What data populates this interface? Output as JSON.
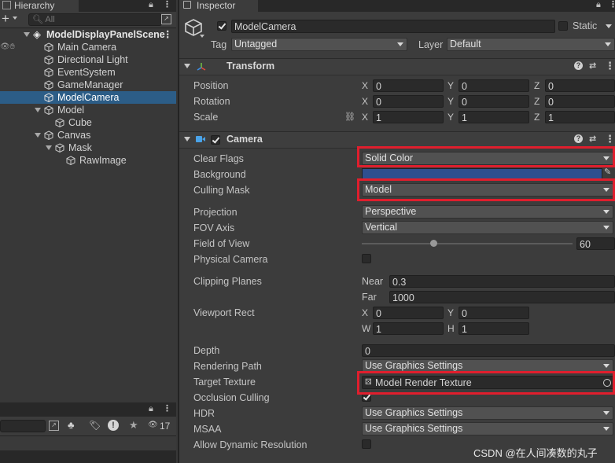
{
  "hierarchy": {
    "tab_label": "Hierarchy",
    "search_placeholder": "All",
    "add_label": "+",
    "scene_name": "ModelDisplayPanelScene",
    "items": [
      {
        "label": "Main Camera"
      },
      {
        "label": "Directional Light"
      },
      {
        "label": "EventSystem"
      },
      {
        "label": "GameManager"
      },
      {
        "label": "ModelCamera",
        "selected": true
      },
      {
        "label": "Model"
      },
      {
        "label": "Cube"
      },
      {
        "label": "Canvas"
      },
      {
        "label": "Mask"
      },
      {
        "label": "RawImage"
      }
    ],
    "bottom_count": "17"
  },
  "inspector": {
    "tab_label": "Inspector",
    "object_name": "ModelCamera",
    "static_label": "Static",
    "tag_label": "Tag",
    "tag_value": "Untagged",
    "layer_label": "Layer",
    "layer_value": "Default",
    "transform": {
      "title": "Transform",
      "rows": [
        {
          "label": "Position",
          "x": "0",
          "y": "0",
          "z": "0"
        },
        {
          "label": "Rotation",
          "x": "0",
          "y": "0",
          "z": "0"
        },
        {
          "label": "Scale",
          "x": "1",
          "y": "1",
          "z": "1"
        }
      ],
      "axis_x": "X",
      "axis_y": "Y",
      "axis_z": "Z"
    },
    "camera": {
      "title": "Camera",
      "clear_flags_label": "Clear Flags",
      "clear_flags_value": "Solid Color",
      "background_label": "Background",
      "background_color": "#2e4f8f",
      "culling_mask_label": "Culling Mask",
      "culling_mask_value": "Model",
      "projection_label": "Projection",
      "projection_value": "Perspective",
      "fov_axis_label": "FOV Axis",
      "fov_axis_value": "Vertical",
      "fov_label": "Field of View",
      "fov_value": "60",
      "fov_slider_fraction": 0.34,
      "physical_camera_label": "Physical Camera",
      "clipping_label": "Clipping Planes",
      "near_label": "Near",
      "near_value": "0.3",
      "far_label": "Far",
      "far_value": "1000",
      "viewport_label": "Viewport Rect",
      "vp_x_label": "X",
      "vp_x": "0",
      "vp_y_label": "Y",
      "vp_y": "0",
      "vp_w_label": "W",
      "vp_w": "1",
      "vp_h_label": "H",
      "vp_h": "1",
      "depth_label": "Depth",
      "depth_value": "0",
      "rendering_path_label": "Rendering Path",
      "rendering_path_value": "Use Graphics Settings",
      "target_texture_label": "Target Texture",
      "target_texture_value": "Model Render Texture",
      "occlusion_label": "Occlusion Culling",
      "hdr_label": "HDR",
      "hdr_value": "Use Graphics Settings",
      "msaa_label": "MSAA",
      "msaa_value": "Use Graphics Settings",
      "dynamic_res_label": "Allow Dynamic Resolution"
    }
  },
  "watermark": "CSDN @在人间凑数的丸子",
  "colors": {
    "highlight_red": "#e01e2d",
    "selection_blue": "#2c5d87"
  }
}
